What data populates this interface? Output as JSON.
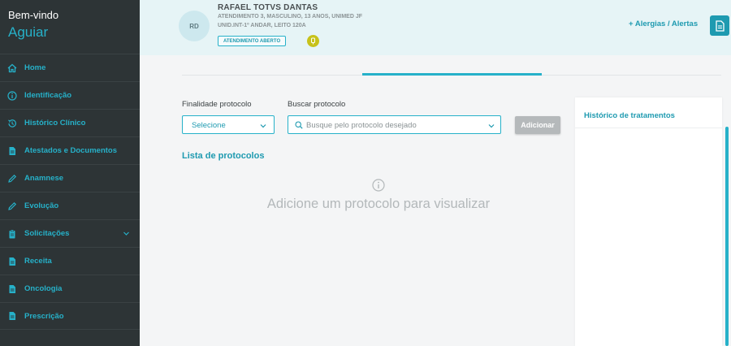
{
  "sidebar": {
    "welcome": "Bem-vindo",
    "user": "Aguiar",
    "items": [
      {
        "label": "Home",
        "icon": "home-icon"
      },
      {
        "label": "Identificação",
        "icon": "info-icon"
      },
      {
        "label": "Histórico Clínico",
        "icon": "history-icon"
      },
      {
        "label": "Atestados e Documentos",
        "icon": "document-icon"
      },
      {
        "label": "Anamnese",
        "icon": "pencil-icon"
      },
      {
        "label": "Evolução",
        "icon": "pencil-icon"
      },
      {
        "label": "Solicitações",
        "icon": "clipboard-icon"
      },
      {
        "label": "Receita",
        "icon": "document-icon"
      },
      {
        "label": "Oncologia",
        "icon": "document-icon"
      },
      {
        "label": "Prescrição",
        "icon": "document-icon"
      }
    ]
  },
  "header": {
    "avatar_initials": "RD",
    "patient_name": "RAFAEL TOTVS DANTAS",
    "line1": "ATENDIMENTO 3, MASCULINO, 13 ANOS, UNIMED JF",
    "line2": "UNID.INT-1º ANDAR, LEITO 120A",
    "status": "ATENDIMENTO ABERTO",
    "alerts": "+ Alergias / Alertas"
  },
  "form": {
    "purpose_label": "Finalidade protocolo",
    "purpose_value": "Selecione",
    "search_label": "Buscar protocolo",
    "search_placeholder": "Busque pelo protocolo desejado",
    "add_button": "Adicionar"
  },
  "list": {
    "title": "Lista de protocolos",
    "empty_message": "Adicione um protocolo para visualizar"
  },
  "panel": {
    "title": "Histórico de tratamentos"
  },
  "colors": {
    "accent": "#26b1c9",
    "sidebar_bg": "#2d3436",
    "header_bg": "#e6f4f6"
  }
}
